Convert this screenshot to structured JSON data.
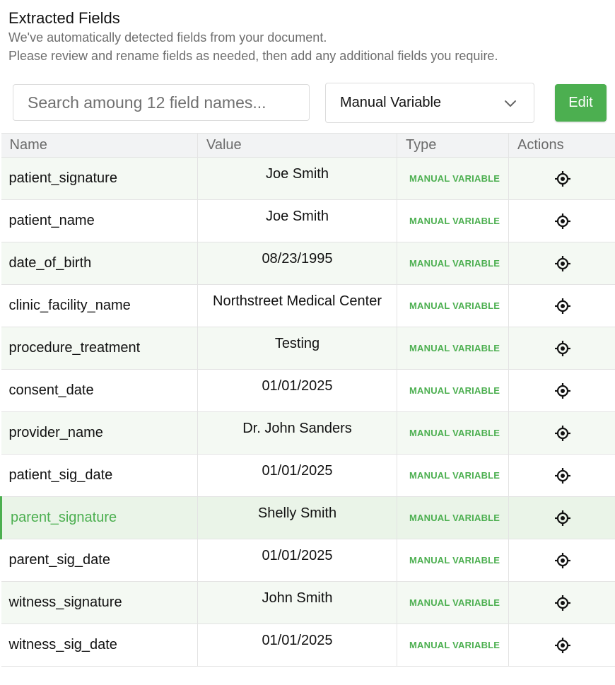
{
  "header": {
    "title": "Extracted Fields",
    "subtitle_line1": "We've automatically detected fields from your document.",
    "subtitle_line2": "Please review and rename fields as needed, then add any additional fields you require."
  },
  "toolbar": {
    "search_placeholder": "Search amoung 12 field names...",
    "type_select_value": "Manual Variable",
    "edit_label": "Edit"
  },
  "colors": {
    "accent": "#4caf50",
    "row_alt": "#f4f9f3",
    "header_bg": "#f2f3f4"
  },
  "table": {
    "columns": [
      "Name",
      "Value",
      "Type",
      "Actions"
    ],
    "selected_row": 8,
    "rows": [
      {
        "name": "patient_signature",
        "value": "Joe Smith",
        "type": "MANUAL VARIABLE",
        "action_icon": "locate-icon"
      },
      {
        "name": "patient_name",
        "value": "Joe Smith",
        "type": "MANUAL VARIABLE",
        "action_icon": "locate-icon"
      },
      {
        "name": "date_of_birth",
        "value": "08/23/1995",
        "type": "MANUAL VARIABLE",
        "action_icon": "locate-icon"
      },
      {
        "name": "clinic_facility_name",
        "value": "Northstreet Medical Center",
        "type": "MANUAL VARIABLE",
        "action_icon": "locate-icon"
      },
      {
        "name": "procedure_treatment",
        "value": "Testing",
        "type": "MANUAL VARIABLE",
        "action_icon": "locate-icon"
      },
      {
        "name": "consent_date",
        "value": "01/01/2025",
        "type": "MANUAL VARIABLE",
        "action_icon": "locate-icon"
      },
      {
        "name": "provider_name",
        "value": "Dr. John Sanders",
        "type": "MANUAL VARIABLE",
        "action_icon": "locate-icon"
      },
      {
        "name": "patient_sig_date",
        "value": "01/01/2025",
        "type": "MANUAL VARIABLE",
        "action_icon": "locate-icon"
      },
      {
        "name": "parent_signature",
        "value": "Shelly Smith",
        "type": "MANUAL VARIABLE",
        "action_icon": "locate-icon"
      },
      {
        "name": "parent_sig_date",
        "value": "01/01/2025",
        "type": "MANUAL VARIABLE",
        "action_icon": "locate-icon"
      },
      {
        "name": "witness_signature",
        "value": "John Smith",
        "type": "MANUAL VARIABLE",
        "action_icon": "locate-icon"
      },
      {
        "name": "witness_sig_date",
        "value": "01/01/2025",
        "type": "MANUAL VARIABLE",
        "action_icon": "locate-icon"
      }
    ]
  }
}
